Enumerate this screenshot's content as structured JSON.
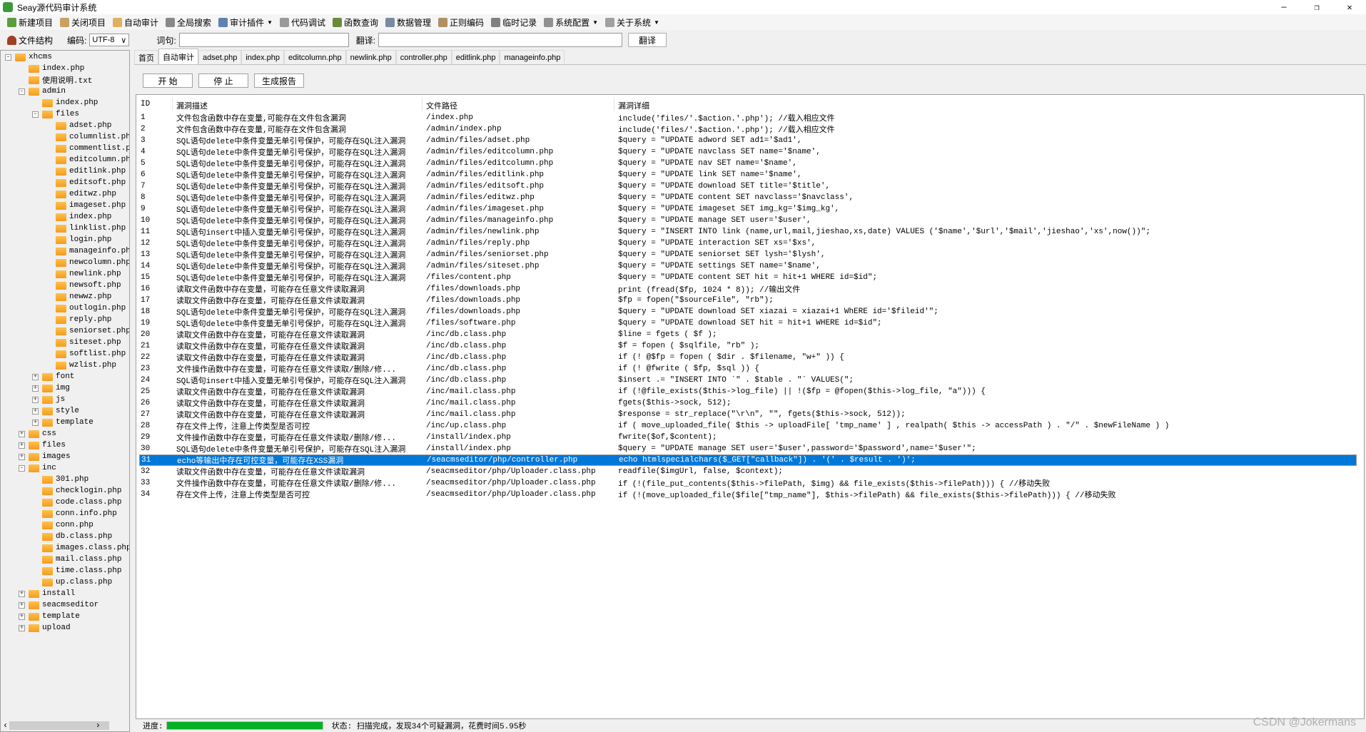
{
  "window": {
    "title": "Seay源代码审计系统",
    "minimize": "—",
    "maximize": "❐",
    "close": "✕"
  },
  "toolbar": [
    {
      "label": "新建项目",
      "icon": "new-project-icon",
      "color": "#5a9e3a"
    },
    {
      "label": "关闭项目",
      "icon": "close-project-icon",
      "color": "#c8a060"
    },
    {
      "label": "自动审计",
      "icon": "auto-audit-icon",
      "color": "#e0b060"
    },
    {
      "label": "全局搜索",
      "icon": "search-icon",
      "color": "#888888"
    },
    {
      "label": "审计插件",
      "icon": "plugin-icon",
      "color": "#6080b0",
      "dropdown": true
    },
    {
      "label": "代码调试",
      "icon": "debug-icon",
      "color": "#999999"
    },
    {
      "label": "函数查询",
      "icon": "function-query-icon",
      "color": "#6a8a3a"
    },
    {
      "label": "数据管理",
      "icon": "data-manage-icon",
      "color": "#7a8aa0"
    },
    {
      "label": "正则编码",
      "icon": "regex-icon",
      "color": "#b09060"
    },
    {
      "label": "临时记录",
      "icon": "notes-icon",
      "color": "#808080"
    },
    {
      "label": "系统配置",
      "icon": "gear-icon",
      "color": "#909090",
      "dropdown": true
    },
    {
      "label": "关于系统",
      "icon": "about-icon",
      "color": "#a0a0a0",
      "dropdown": true
    }
  ],
  "bar2": {
    "file_structure": "文件结构",
    "encoding_label": "编码:",
    "encoding_value": "UTF-8",
    "word_label": "词句:",
    "word_value": "",
    "translate_label": "翻译:",
    "translate_value": "",
    "translate_button": "翻译"
  },
  "tree": [
    {
      "l": 0,
      "t": "-",
      "n": "xhcms"
    },
    {
      "l": 1,
      "t": "",
      "n": "index.php"
    },
    {
      "l": 1,
      "t": "",
      "n": "使用说明.txt"
    },
    {
      "l": 1,
      "t": "-",
      "n": "admin"
    },
    {
      "l": 2,
      "t": "",
      "n": "index.php"
    },
    {
      "l": 2,
      "t": "-",
      "n": "files"
    },
    {
      "l": 3,
      "t": "",
      "n": "adset.php"
    },
    {
      "l": 3,
      "t": "",
      "n": "columnlist.php"
    },
    {
      "l": 3,
      "t": "",
      "n": "commentlist.php"
    },
    {
      "l": 3,
      "t": "",
      "n": "editcolumn.php"
    },
    {
      "l": 3,
      "t": "",
      "n": "editlink.php"
    },
    {
      "l": 3,
      "t": "",
      "n": "editsoft.php"
    },
    {
      "l": 3,
      "t": "",
      "n": "editwz.php"
    },
    {
      "l": 3,
      "t": "",
      "n": "imageset.php"
    },
    {
      "l": 3,
      "t": "",
      "n": "index.php"
    },
    {
      "l": 3,
      "t": "",
      "n": "linklist.php"
    },
    {
      "l": 3,
      "t": "",
      "n": "login.php"
    },
    {
      "l": 3,
      "t": "",
      "n": "manageinfo.php"
    },
    {
      "l": 3,
      "t": "",
      "n": "newcolumn.php"
    },
    {
      "l": 3,
      "t": "",
      "n": "newlink.php"
    },
    {
      "l": 3,
      "t": "",
      "n": "newsoft.php"
    },
    {
      "l": 3,
      "t": "",
      "n": "newwz.php"
    },
    {
      "l": 3,
      "t": "",
      "n": "outlogin.php"
    },
    {
      "l": 3,
      "t": "",
      "n": "reply.php"
    },
    {
      "l": 3,
      "t": "",
      "n": "seniorset.php"
    },
    {
      "l": 3,
      "t": "",
      "n": "siteset.php"
    },
    {
      "l": 3,
      "t": "",
      "n": "softlist.php"
    },
    {
      "l": 3,
      "t": "",
      "n": "wzlist.php"
    },
    {
      "l": 2,
      "t": "+",
      "n": "font"
    },
    {
      "l": 2,
      "t": "+",
      "n": "img"
    },
    {
      "l": 2,
      "t": "+",
      "n": "js"
    },
    {
      "l": 2,
      "t": "+",
      "n": "style"
    },
    {
      "l": 2,
      "t": "+",
      "n": "template"
    },
    {
      "l": 1,
      "t": "+",
      "n": "css"
    },
    {
      "l": 1,
      "t": "+",
      "n": "files"
    },
    {
      "l": 1,
      "t": "+",
      "n": "images"
    },
    {
      "l": 1,
      "t": "-",
      "n": "inc"
    },
    {
      "l": 2,
      "t": "",
      "n": "301.php"
    },
    {
      "l": 2,
      "t": "",
      "n": "checklogin.php"
    },
    {
      "l": 2,
      "t": "",
      "n": "code.class.php"
    },
    {
      "l": 2,
      "t": "",
      "n": "conn.info.php"
    },
    {
      "l": 2,
      "t": "",
      "n": "conn.php"
    },
    {
      "l": 2,
      "t": "",
      "n": "db.class.php"
    },
    {
      "l": 2,
      "t": "",
      "n": "images.class.php"
    },
    {
      "l": 2,
      "t": "",
      "n": "mail.class.php"
    },
    {
      "l": 2,
      "t": "",
      "n": "time.class.php"
    },
    {
      "l": 2,
      "t": "",
      "n": "up.class.php"
    },
    {
      "l": 1,
      "t": "+",
      "n": "install"
    },
    {
      "l": 1,
      "t": "+",
      "n": "seacmseditor"
    },
    {
      "l": 1,
      "t": "+",
      "n": "template"
    },
    {
      "l": 1,
      "t": "+",
      "n": "upload"
    }
  ],
  "tabs": [
    {
      "label": "首页"
    },
    {
      "label": "自动审计",
      "active": true
    },
    {
      "label": "adset.php"
    },
    {
      "label": "index.php"
    },
    {
      "label": "editcolumn.php"
    },
    {
      "label": "newlink.php"
    },
    {
      "label": "controller.php"
    },
    {
      "label": "editlink.php"
    },
    {
      "label": "manageinfo.php"
    }
  ],
  "buttons": {
    "start": "开 始",
    "stop": "停 止",
    "report": "生成报告"
  },
  "table": {
    "columns": [
      "ID",
      "漏洞描述",
      "文件路径",
      "漏洞详细"
    ],
    "selected_id": "31",
    "rows": [
      [
        "1",
        "文件包含函数中存在变量,可能存在文件包含漏洞",
        "/index.php",
        "include('files/'.$action.'.php'); //载入相应文件"
      ],
      [
        "2",
        "文件包含函数中存在变量,可能存在文件包含漏洞",
        "/admin/index.php",
        "include('files/'.$action.'.php'); //载入相应文件"
      ],
      [
        "3",
        "SQL语句delete中条件变量无单引号保护，可能存在SQL注入漏洞",
        "/admin/files/adset.php",
        "$query = \"UPDATE adword SET ad1='$ad1',"
      ],
      [
        "4",
        "SQL语句delete中条件变量无单引号保护，可能存在SQL注入漏洞",
        "/admin/files/editcolumn.php",
        "$query = \"UPDATE navclass SET name='$name',"
      ],
      [
        "5",
        "SQL语句delete中条件变量无单引号保护，可能存在SQL注入漏洞",
        "/admin/files/editcolumn.php",
        "$query = \"UPDATE nav SET name='$name',"
      ],
      [
        "6",
        "SQL语句delete中条件变量无单引号保护，可能存在SQL注入漏洞",
        "/admin/files/editlink.php",
        "$query = \"UPDATE link SET name='$name',"
      ],
      [
        "7",
        "SQL语句delete中条件变量无单引号保护，可能存在SQL注入漏洞",
        "/admin/files/editsoft.php",
        "$query = \"UPDATE download SET title='$title',"
      ],
      [
        "8",
        "SQL语句delete中条件变量无单引号保护，可能存在SQL注入漏洞",
        "/admin/files/editwz.php",
        "$query = \"UPDATE content SET navclass='$navclass',"
      ],
      [
        "9",
        "SQL语句delete中条件变量无单引号保护，可能存在SQL注入漏洞",
        "/admin/files/imageset.php",
        "$query = \"UPDATE imageset SET img_kg='$img_kg',"
      ],
      [
        "10",
        "SQL语句delete中条件变量无单引号保护，可能存在SQL注入漏洞",
        "/admin/files/manageinfo.php",
        "$query = \"UPDATE manage SET user='$user',"
      ],
      [
        "11",
        "SQL语句insert中插入变量无单引号保护，可能存在SQL注入漏洞",
        "/admin/files/newlink.php",
        "$query = \"INSERT INTO link (name,url,mail,jieshao,xs,date) VALUES ('$name','$url','$mail','jieshao','xs',now())\";"
      ],
      [
        "12",
        "SQL语句delete中条件变量无单引号保护，可能存在SQL注入漏洞",
        "/admin/files/reply.php",
        "$query = \"UPDATE interaction SET xs='$xs',"
      ],
      [
        "13",
        "SQL语句delete中条件变量无单引号保护，可能存在SQL注入漏洞",
        "/admin/files/seniorset.php",
        "$query = \"UPDATE seniorset SET lysh='$lysh',"
      ],
      [
        "14",
        "SQL语句delete中条件变量无单引号保护，可能存在SQL注入漏洞",
        "/admin/files/siteset.php",
        "$query = \"UPDATE settings SET name='$name',"
      ],
      [
        "15",
        "SQL语句delete中条件变量无单引号保护，可能存在SQL注入漏洞",
        "/files/content.php",
        "$query = \"UPDATE content SET hit = hit+1 WHERE id=$id\";"
      ],
      [
        "16",
        "读取文件函数中存在变量，可能存在任意文件读取漏洞",
        "/files/downloads.php",
        "print (fread($fp, 1024 * 8)); //输出文件"
      ],
      [
        "17",
        "读取文件函数中存在变量，可能存在任意文件读取漏洞",
        "/files/downloads.php",
        "$fp = fopen(\"$sourceFile\", \"rb\");"
      ],
      [
        "18",
        "SQL语句delete中条件变量无单引号保护，可能存在SQL注入漏洞",
        "/files/downloads.php",
        "$query = \"UPDATE download SET xiazai = xiazai+1 WhERE id='$fileid'\";"
      ],
      [
        "19",
        "SQL语句delete中条件变量无单引号保护，可能存在SQL注入漏洞",
        "/files/software.php",
        "$query = \"UPDATE download SET hit = hit+1 WHERE id=$id\";"
      ],
      [
        "20",
        "读取文件函数中存在变量，可能存在任意文件读取漏洞",
        "/inc/db.class.php",
        "$line = fgets ( $f );"
      ],
      [
        "21",
        "读取文件函数中存在变量，可能存在任意文件读取漏洞",
        "/inc/db.class.php",
        "$f = fopen ( $sqlfile, \"rb\" );"
      ],
      [
        "22",
        "读取文件函数中存在变量，可能存在任意文件读取漏洞",
        "/inc/db.class.php",
        "if (! @$fp = fopen ( $dir . $filename, \"w+\" )) {"
      ],
      [
        "23",
        "文件操作函数中存在变量，可能存在任意文件读取/删除/修...",
        "/inc/db.class.php",
        "if (! @fwrite ( $fp, $sql )) {"
      ],
      [
        "24",
        "SQL语句insert中插入变量无单引号保护，可能存在SQL注入漏洞",
        "/inc/db.class.php",
        "$insert .= \"INSERT INTO `\" . $table . \"` VALUES(\";"
      ],
      [
        "25",
        "读取文件函数中存在变量，可能存在任意文件读取漏洞",
        "/inc/mail.class.php",
        "if (!@file_exists($this->log_file) || !($fp = @fopen($this->log_file, \"a\"))) {"
      ],
      [
        "26",
        "读取文件函数中存在变量，可能存在任意文件读取漏洞",
        "/inc/mail.class.php",
        "fgets($this->sock, 512);"
      ],
      [
        "27",
        "读取文件函数中存在变量，可能存在任意文件读取漏洞",
        "/inc/mail.class.php",
        "$response = str_replace(\"\\r\\n\", \"\", fgets($this->sock, 512));"
      ],
      [
        "28",
        "存在文件上传，注意上传类型是否可控",
        "/inc/up.class.php",
        "if ( move_uploaded_file( $this -> uploadFile[ 'tmp_name' ] , realpath( $this -> accessPath ) . \"/\" . $newFileName ) )"
      ],
      [
        "29",
        "文件操作函数中存在变量，可能存在任意文件读取/删除/修...",
        "/install/index.php",
        "fwrite($of,$content);"
      ],
      [
        "30",
        "SQL语句delete中条件变量无单引号保护，可能存在SQL注入漏洞",
        "/install/index.php",
        "$query = \"UPDATE manage SET user='$user',password='$password',name='$user'\";"
      ],
      [
        "31",
        "echo等输出中存在可控变量，可能存在XSS漏洞",
        "/seacmseditor/php/controller.php",
        "echo htmlspecialchars($_GET[\"callback\"]) . '(' . $result . ')';"
      ],
      [
        "32",
        "读取文件函数中存在变量，可能存在任意文件读取漏洞",
        "/seacmseditor/php/Uploader.class.php",
        "readfile($imgUrl, false, $context);"
      ],
      [
        "33",
        "文件操作函数中存在变量，可能存在任意文件读取/删除/修...",
        "/seacmseditor/php/Uploader.class.php",
        "if (!(file_put_contents($this->filePath, $img) && file_exists($this->filePath))) { //移动失败"
      ],
      [
        "34",
        "存在文件上传，注意上传类型是否可控",
        "/seacmseditor/php/Uploader.class.php",
        "if (!(move_uploaded_file($file[\"tmp_name\"], $this->filePath) && file_exists($this->filePath))) { //移动失败"
      ]
    ]
  },
  "status": {
    "progress_label": "进度:",
    "progress_percent": 100,
    "progress_color": "#06b025",
    "text": "状态: 扫描完成，发现34个可疑漏洞，花费时间5.95秒"
  },
  "watermark": "CSDN @Jokermans",
  "colors": {
    "selection": "#0078d7"
  }
}
